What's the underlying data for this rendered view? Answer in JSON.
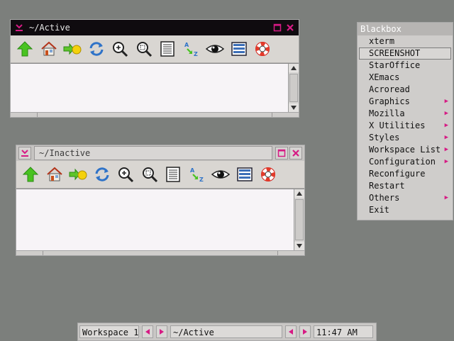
{
  "colors": {
    "desktop": "#7c7f7c",
    "accent": "#d61a84",
    "active_title_bg": "#0f0b0f"
  },
  "windows": [
    {
      "state": "active",
      "title": "~/Active",
      "toolbar_icons": [
        "up-arrow-icon",
        "home-icon",
        "go-forward-icon",
        "reload-icon",
        "zoom-in-icon",
        "zoom-fit-icon",
        "list-view-icon",
        "sort-az-icon",
        "eye-icon",
        "detail-view-icon",
        "help-lifebuoy-icon"
      ]
    },
    {
      "state": "inactive",
      "title": "~/Inactive",
      "toolbar_icons": [
        "up-arrow-icon",
        "home-icon",
        "go-forward-icon",
        "reload-icon",
        "zoom-in-icon",
        "zoom-fit-icon",
        "list-view-icon",
        "sort-az-icon",
        "eye-icon",
        "detail-view-icon",
        "help-lifebuoy-icon"
      ]
    }
  ],
  "menu": {
    "title": "Blackbox",
    "items": [
      {
        "label": "xterm",
        "submenu": false
      },
      {
        "label": "SCREENSHOT",
        "submenu": false,
        "selected": true
      },
      {
        "label": "StarOffice",
        "submenu": false
      },
      {
        "label": "XEmacs",
        "submenu": false
      },
      {
        "label": "Acroread",
        "submenu": false
      },
      {
        "label": "Graphics",
        "submenu": true
      },
      {
        "label": "Mozilla",
        "submenu": true
      },
      {
        "label": "X Utilities",
        "submenu": true
      },
      {
        "label": "Styles",
        "submenu": true
      },
      {
        "label": "Workspace List",
        "submenu": true
      },
      {
        "label": "Configuration",
        "submenu": true
      },
      {
        "label": "Reconfigure",
        "submenu": false
      },
      {
        "label": "Restart",
        "submenu": false
      },
      {
        "label": "Others",
        "submenu": true
      },
      {
        "label": "Exit",
        "submenu": false
      }
    ]
  },
  "bbtoolbar": {
    "workspace_label": "Workspace 1",
    "window_label": "~/Active",
    "clock": "11:47 AM"
  }
}
